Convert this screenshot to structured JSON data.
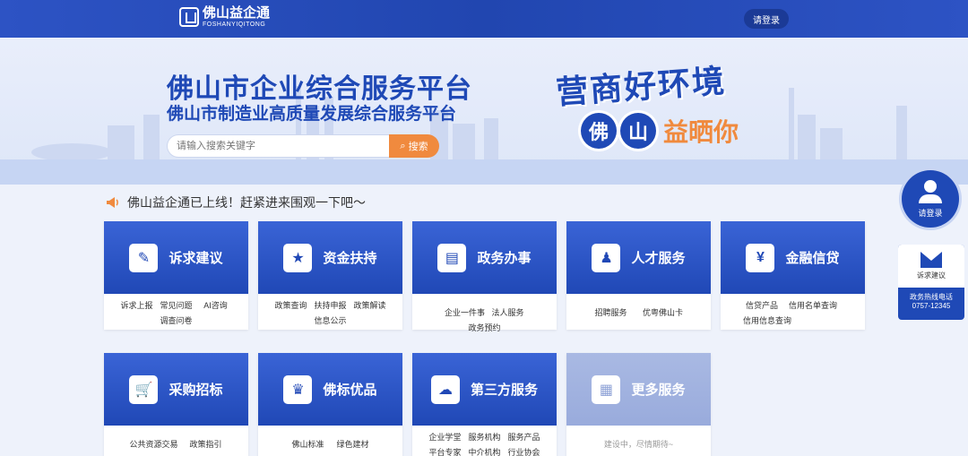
{
  "header": {
    "brand_cn": "佛山益企通",
    "brand_en": "FOSHANYIQITONG",
    "login_label": "请登录"
  },
  "banner": {
    "title": "佛山市企业综合服务平台",
    "subtitle": "佛山市制造业高质量发展综合服务平台",
    "search_placeholder": "请输入搜索关键字",
    "search_button": "搜索",
    "slogan_main": "营商好环境",
    "slogan_circle1": "佛",
    "slogan_circle2": "山",
    "slogan_tail": "益晒你"
  },
  "notice": {
    "icon": "megaphone-icon",
    "text": "佛山益企通已上线！赶紧进来围观一下吧～"
  },
  "cards": [
    {
      "title": "诉求建议",
      "icon": "edit-icon",
      "glyph": "✎",
      "links": [
        "诉求上报",
        "常见问题",
        "AI咨询",
        "调查问卷"
      ]
    },
    {
      "title": "资金扶持",
      "icon": "funding-icon",
      "glyph": "★",
      "links": [
        "政策查询",
        "扶持申报",
        "政策解读",
        "信息公示"
      ]
    },
    {
      "title": "政务办事",
      "icon": "document-icon",
      "glyph": "▤",
      "links": [
        "企业一件事",
        "法人服务",
        "政务预约"
      ]
    },
    {
      "title": "人才服务",
      "icon": "person-icon",
      "glyph": "♟",
      "links": [
        "招聘服务",
        "优粤佛山卡"
      ]
    },
    {
      "title": "金融信贷",
      "icon": "moneybag-icon",
      "glyph": "¥",
      "links": [
        "信贷产品",
        "信用名单查询",
        "信用信息查询"
      ]
    },
    {
      "title": "采购招标",
      "icon": "cart-icon",
      "glyph": "🛒",
      "links": [
        "公共资源交易",
        "政策指引"
      ]
    },
    {
      "title": "佛标优品",
      "icon": "trophy-icon",
      "glyph": "♛",
      "links": [
        "佛山标准",
        "绿色建材"
      ]
    },
    {
      "title": "第三方服务",
      "icon": "cloud-icon",
      "glyph": "☁",
      "links": [
        "企业学堂",
        "服务机构",
        "服务产品",
        "平台专家",
        "中介机构",
        "行业协会"
      ]
    },
    {
      "title": "更多服务",
      "icon": "grid-icon",
      "glyph": "▦",
      "links": [
        "建设中，尽情期待~"
      ]
    }
  ],
  "side": {
    "user_label": "请登录",
    "feedback_label": "诉求建议",
    "hotline_label": "政务热线电话",
    "hotline_number": "0757-12345"
  }
}
